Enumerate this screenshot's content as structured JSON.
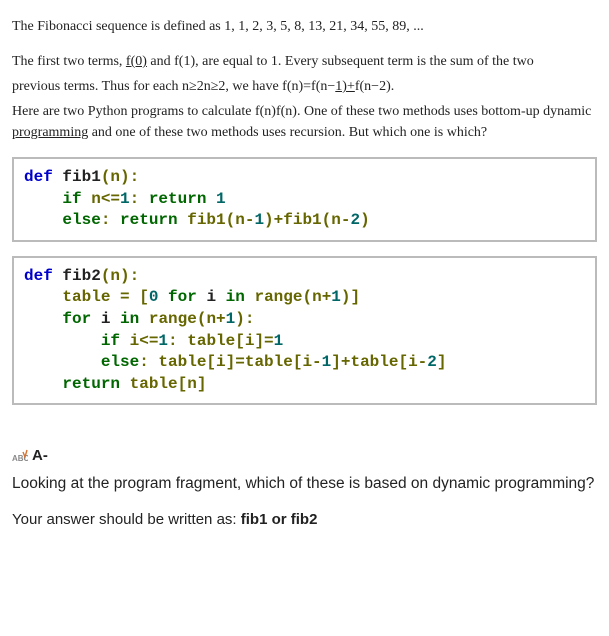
{
  "intro": {
    "line1": "The Fibonacci sequence is defined as 1, 1, 2, 3, 5, 8, 13, 21, 34, 55, 89, ...",
    "line2a": "The first two terms, ",
    "line2_f0": "f(0)",
    "line2b": " and f(1), are equal to 1. Every subsequent term is the sum of the two",
    "line3a": "previous terms. Thus for each ",
    "line3_cond": "n≥2n≥2",
    "line3b": ", we have ",
    "line3_eq": "f(n)=f(n−1)+f(n−2).",
    "line4a": "Here are two Python programs to calculate ",
    "line4_fn": "f(n)f(n)",
    "line4b": ". One of these two methods uses bottom-up dynamic ",
    "line4_prog": "programming",
    "line4c": " and one of these two methods uses recursion. But which one is which?"
  },
  "code1": {
    "l1_def": "def",
    "l1_name": " fib1",
    "l1_rest": "(n):",
    "l2_if": "if",
    "l2_cond": " n<=",
    "l2_num": "1",
    "l2_colon": ": ",
    "l2_ret": "return",
    "l2_val": " 1",
    "l3_else": "else",
    "l3_colon": ": ",
    "l3_ret": "return",
    "l3_expr_a": " fib1(n-",
    "l3_n1": "1",
    "l3_mid": ")+fib1(n-",
    "l3_n2": "2",
    "l3_end": ")"
  },
  "code2": {
    "l1_def": "def",
    "l1_name": " fib2",
    "l1_rest": "(n):",
    "l2a": "    table = [",
    "l2_zero": "0",
    "l2b": " ",
    "l2_for": "for",
    "l2c": " i ",
    "l2_in": "in",
    "l2d": " range(n+",
    "l2_one": "1",
    "l2e": ")]",
    "l3a": "    ",
    "l3_for": "for",
    "l3b": " i ",
    "l3_in": "in",
    "l3c": " range(n+",
    "l3_one": "1",
    "l3d": "):",
    "l4a": "        ",
    "l4_if": "if",
    "l4b": " i<=",
    "l4_one": "1",
    "l4c": ": table[i]=",
    "l4_one2": "1",
    "l5a": "        ",
    "l5_else": "else",
    "l5b": ": table[i]=table[i-",
    "l5_one": "1",
    "l5c": "]+table[i-",
    "l5_two": "2",
    "l5d": "]",
    "l6a": "    ",
    "l6_ret": "return",
    "l6b": " table[n]"
  },
  "question": {
    "label": "A-",
    "text": "Looking at the program fragment, which of these is based on dynamic programming?",
    "hint_a": "Your answer should be written as: ",
    "hint_b": "fib1 or fib2"
  }
}
